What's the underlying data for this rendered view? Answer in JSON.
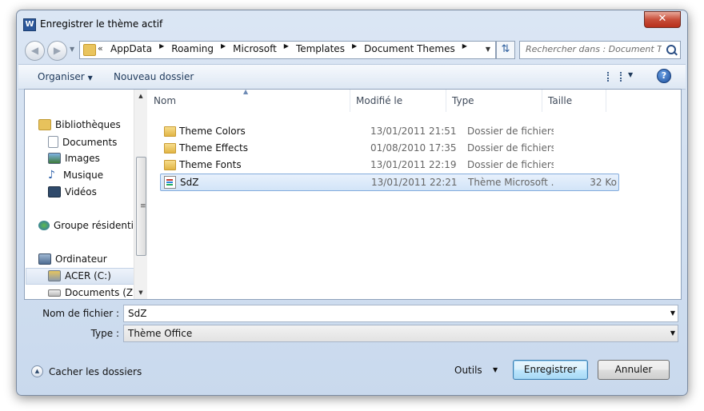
{
  "window": {
    "title": "Enregistrer le thème actif",
    "app_icon": "W",
    "close": "✕"
  },
  "address": {
    "chevron": "«",
    "crumbs": [
      "AppData",
      "Roaming",
      "Microsoft",
      "Templates",
      "Document Themes"
    ]
  },
  "search": {
    "placeholder": "Rechercher dans : Document T..."
  },
  "toolbar": {
    "organize": "Organiser",
    "new_folder": "Nouveau dossier",
    "help": "?"
  },
  "nav": {
    "items": [
      {
        "label": "Bibliothèques"
      },
      {
        "label": "Documents"
      },
      {
        "label": "Images"
      },
      {
        "label": "Musique"
      },
      {
        "label": "Vidéos"
      },
      {
        "label": "Groupe résidentiel"
      },
      {
        "label": "Ordinateur"
      },
      {
        "label": "ACER (C:)"
      },
      {
        "label": "Documents (Z:)"
      }
    ]
  },
  "columns": {
    "name": "Nom",
    "modified": "Modifié le",
    "type": "Type",
    "size": "Taille"
  },
  "files": [
    {
      "name": "Theme Colors",
      "modified": "13/01/2011 21:51",
      "type": "Dossier de fichiers",
      "size": ""
    },
    {
      "name": "Theme Effects",
      "modified": "01/08/2010 17:35",
      "type": "Dossier de fichiers",
      "size": ""
    },
    {
      "name": "Theme Fonts",
      "modified": "13/01/2011 22:19",
      "type": "Dossier de fichiers",
      "size": ""
    },
    {
      "name": "SdZ",
      "modified": "13/01/2011 22:21",
      "type": "Thème Microsoft ...",
      "size": "32 Ko"
    }
  ],
  "form": {
    "filename_label": "Nom de fichier :",
    "filename_value": "SdZ",
    "type_label": "Type :",
    "type_value": "Thème Office"
  },
  "footer": {
    "hide_folders": "Cacher les dossiers",
    "tools": "Outils",
    "save": "Enregistrer",
    "cancel": "Annuler"
  }
}
